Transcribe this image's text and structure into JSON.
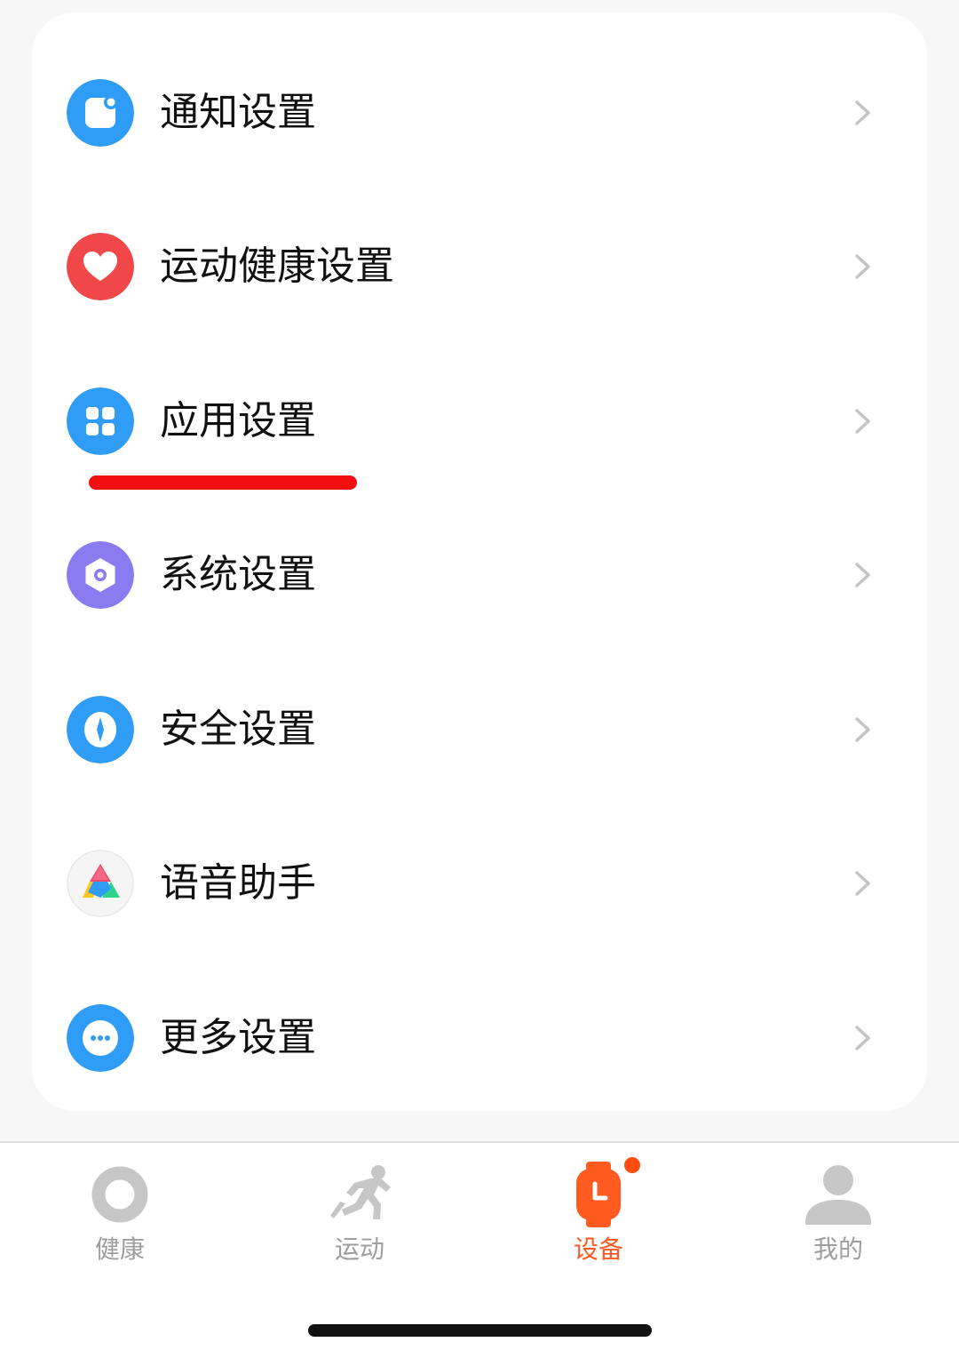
{
  "colors": {
    "background": "#f7f7f7",
    "card": "#ffffff",
    "accent_active": "#ff5a1f",
    "tab_inactive": "#9e9e9e",
    "annotation_underline": "#f20f0f"
  },
  "settings": {
    "items": [
      {
        "label": "通知设置",
        "icon": "notification-icon",
        "color": "#2f9cf5"
      },
      {
        "label": "运动健康设置",
        "icon": "heart-icon",
        "color": "#f04848"
      },
      {
        "label": "应用设置",
        "icon": "apps-grid-icon",
        "color": "#2f9cf5"
      },
      {
        "label": "系统设置",
        "icon": "hexagon-settings-icon",
        "color": "#8a7cf0"
      },
      {
        "label": "安全设置",
        "icon": "shield-icon",
        "color": "#2f9cf5"
      },
      {
        "label": "语音助手",
        "icon": "voice-assistant-icon",
        "color": "#f3f3f3"
      },
      {
        "label": "更多设置",
        "icon": "more-dots-icon",
        "color": "#2f9cf5"
      }
    ],
    "chevron_icon": "chevron-right-icon",
    "annotation": "red underline below 应用设置"
  },
  "tabbar": {
    "items": [
      {
        "label": "健康",
        "icon": "health-ring-icon",
        "active": false
      },
      {
        "label": "运动",
        "icon": "running-icon",
        "active": false
      },
      {
        "label": "设备",
        "icon": "watch-icon",
        "active": true,
        "badge": "dot"
      },
      {
        "label": "我的",
        "icon": "profile-icon",
        "active": false
      }
    ]
  }
}
